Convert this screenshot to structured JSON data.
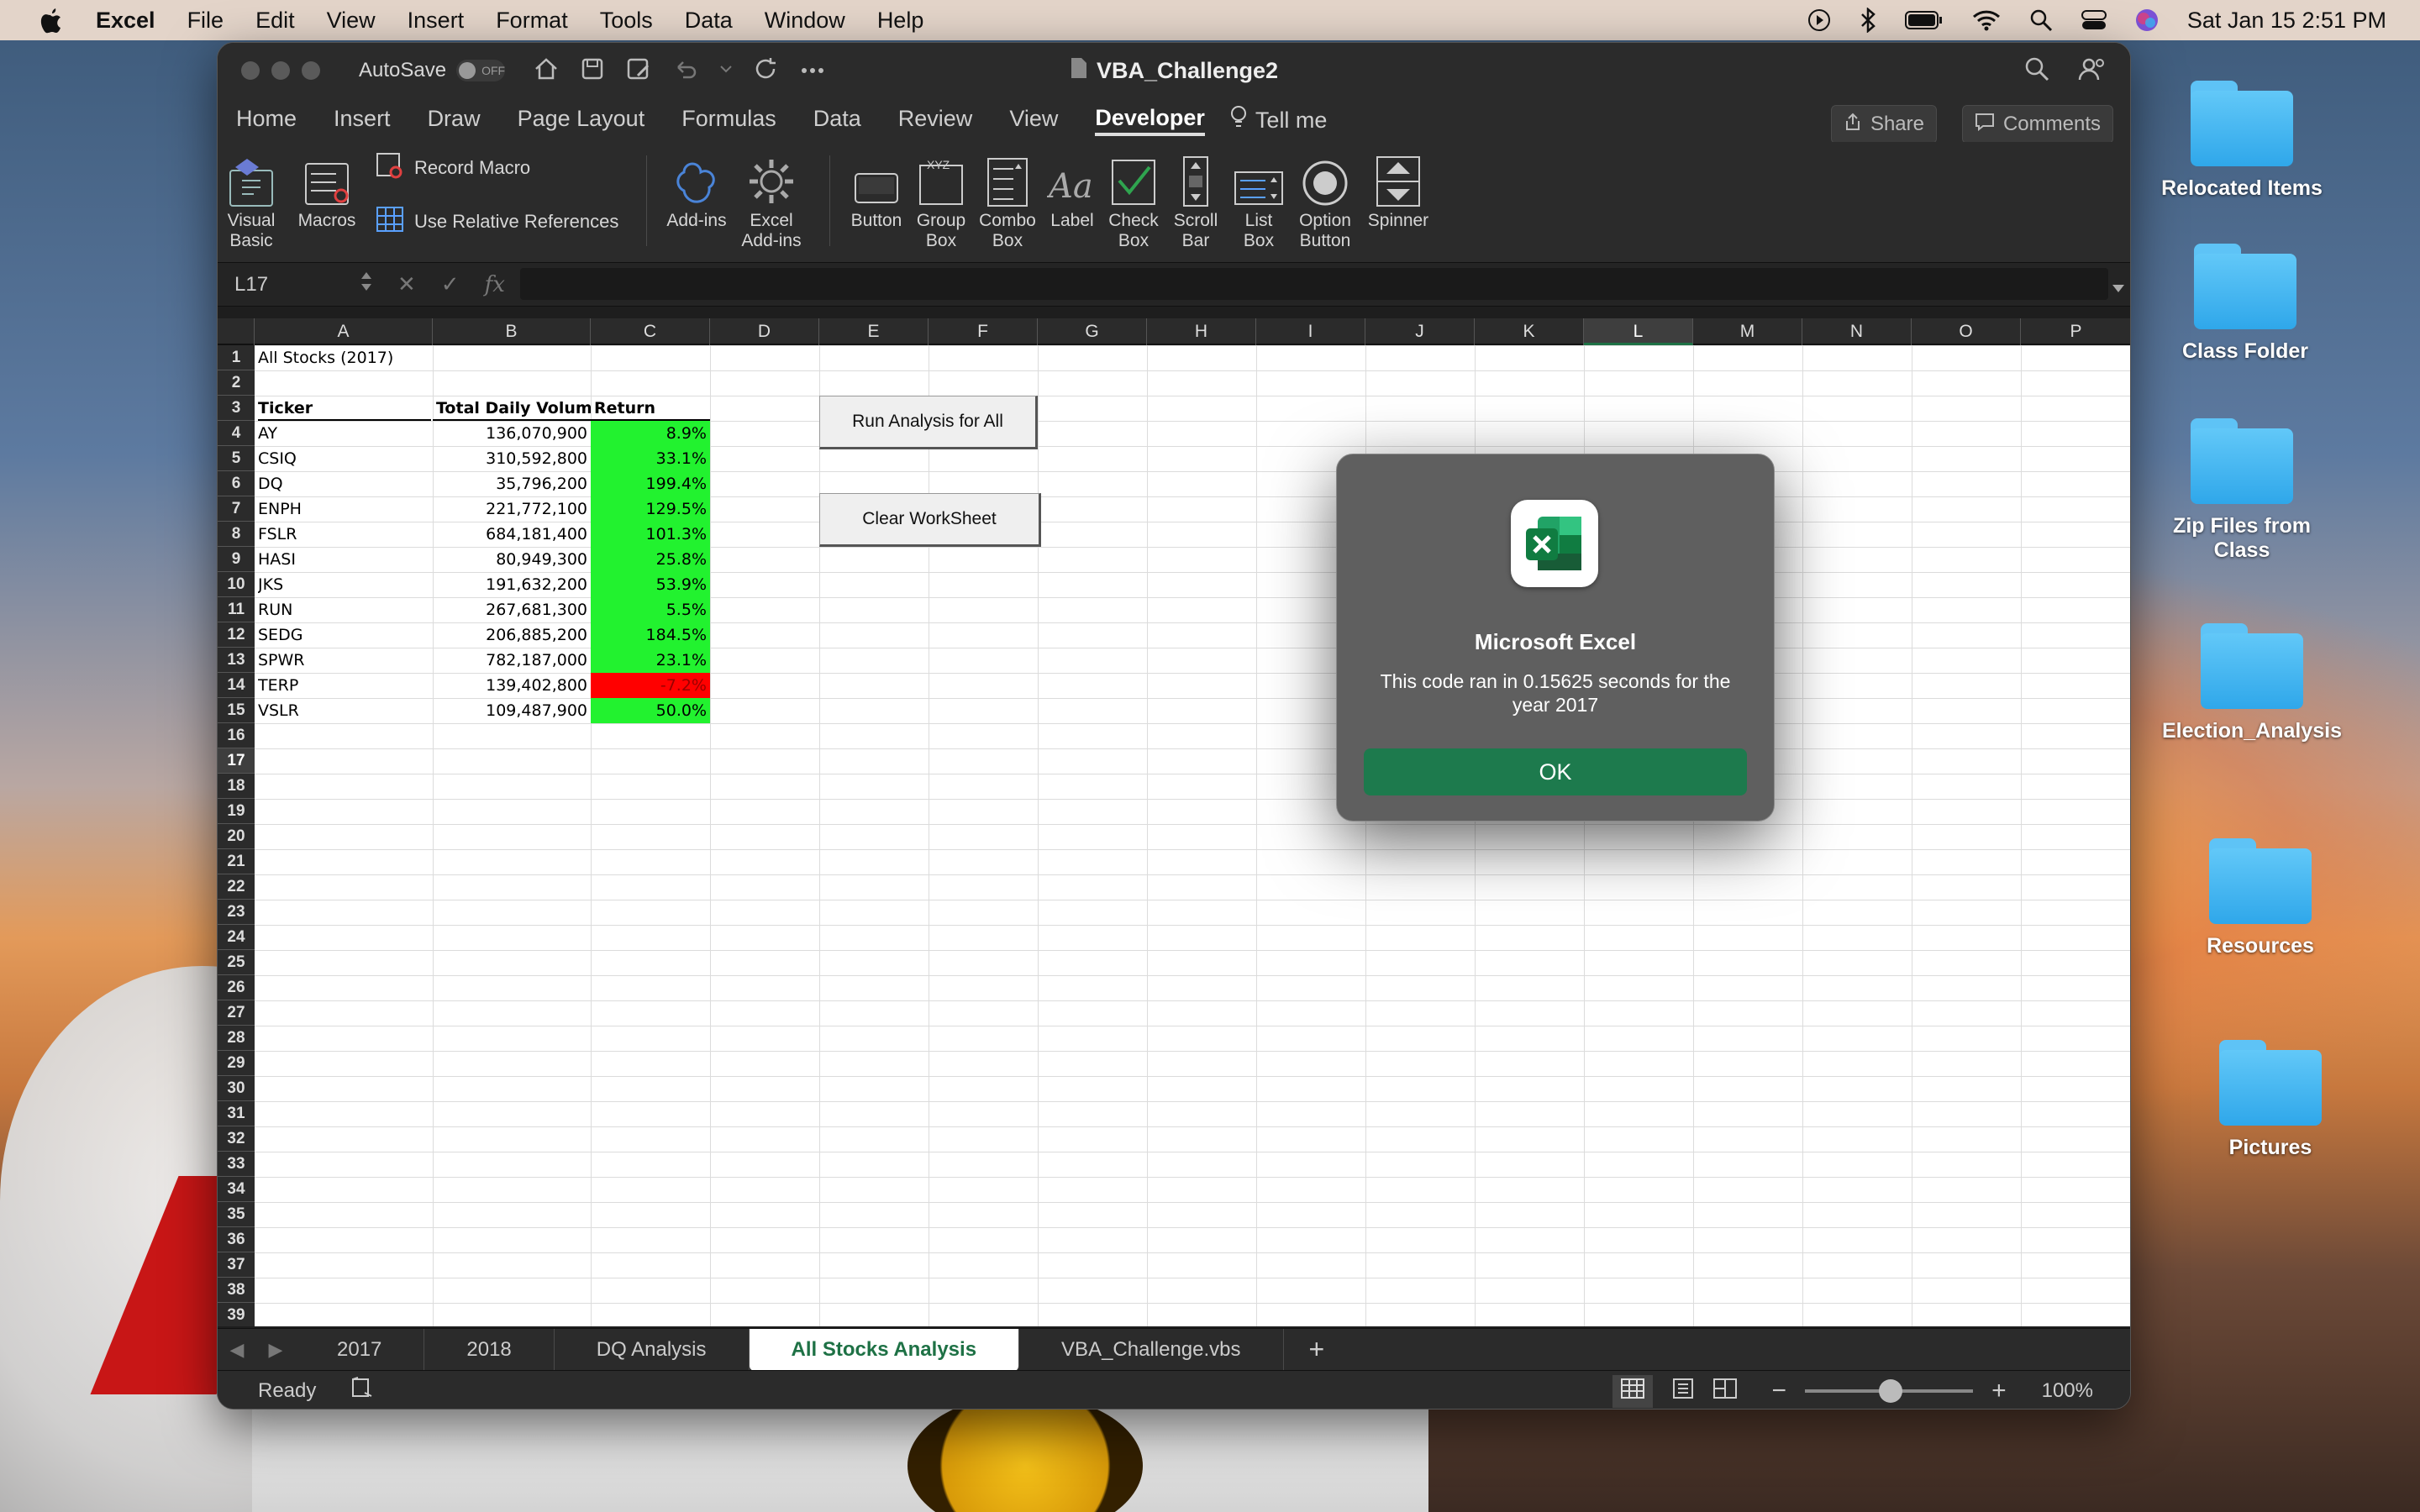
{
  "menubar": {
    "app": "Excel",
    "items": [
      "File",
      "Edit",
      "View",
      "Insert",
      "Format",
      "Tools",
      "Data",
      "Window",
      "Help"
    ],
    "clock": "Sat Jan 15  2:51 PM"
  },
  "window": {
    "autosave_label": "AutoSave",
    "autosave_state": "OFF",
    "title": "VBA_Challenge2"
  },
  "ribbon_tabs": [
    "Home",
    "Insert",
    "Draw",
    "Page Layout",
    "Formulas",
    "Data",
    "Review",
    "View",
    "Developer"
  ],
  "active_tab": "Developer",
  "tell_me": "Tell me",
  "share": "Share",
  "comments": "Comments",
  "ribbon": {
    "visual_basic": "Visual Basic",
    "macros": "Macros",
    "record_macro": "Record Macro",
    "use_relative": "Use Relative References",
    "add_ins": "Add-ins",
    "excel_add_ins": "Excel Add-ins",
    "button": "Button",
    "group_box": "Group Box",
    "combo_box": "Combo Box",
    "label": "Label",
    "check_box": "Check Box",
    "scroll_bar": "Scroll Bar",
    "list_box": "List Box",
    "option_button": "Option Button",
    "spinner": "Spinner"
  },
  "formula_bar": {
    "name_box": "L17",
    "fx": "fx",
    "value": ""
  },
  "columns": [
    "A",
    "B",
    "C",
    "D",
    "E",
    "F",
    "G",
    "H",
    "I",
    "J",
    "K",
    "L",
    "M",
    "N",
    "O",
    "P"
  ],
  "selected_column": "L",
  "selected_row": 17,
  "sheet": {
    "title": "All Stocks (2017)",
    "headers": [
      "Ticker",
      "Total Daily Volume",
      "Return"
    ],
    "rows": [
      {
        "ticker": "AY",
        "volume": "136,070,900",
        "ret": "8.9%",
        "positive": true
      },
      {
        "ticker": "CSIQ",
        "volume": "310,592,800",
        "ret": "33.1%",
        "positive": true
      },
      {
        "ticker": "DQ",
        "volume": "35,796,200",
        "ret": "199.4%",
        "positive": true
      },
      {
        "ticker": "ENPH",
        "volume": "221,772,100",
        "ret": "129.5%",
        "positive": true
      },
      {
        "ticker": "FSLR",
        "volume": "684,181,400",
        "ret": "101.3%",
        "positive": true
      },
      {
        "ticker": "HASI",
        "volume": "80,949,300",
        "ret": "25.8%",
        "positive": true
      },
      {
        "ticker": "JKS",
        "volume": "191,632,200",
        "ret": "53.9%",
        "positive": true
      },
      {
        "ticker": "RUN",
        "volume": "267,681,300",
        "ret": "5.5%",
        "positive": true
      },
      {
        "ticker": "SEDG",
        "volume": "206,885,200",
        "ret": "184.5%",
        "positive": true
      },
      {
        "ticker": "SPWR",
        "volume": "782,187,000",
        "ret": "23.1%",
        "positive": true
      },
      {
        "ticker": "TERP",
        "volume": "139,402,800",
        "ret": "-7.2%",
        "positive": false
      },
      {
        "ticker": "VSLR",
        "volume": "109,487,900",
        "ret": "50.0%",
        "positive": true
      }
    ],
    "run_button": "Run Analysis for All",
    "clear_button": "Clear WorkSheet"
  },
  "sheet_tabs": [
    "2017",
    "2018",
    "DQ Analysis",
    "All Stocks Analysis",
    "VBA_Challenge.vbs"
  ],
  "active_sheet": "All Stocks Analysis",
  "status": {
    "ready": "Ready",
    "zoom": "100%"
  },
  "dialog": {
    "title": "Microsoft Excel",
    "message": "This code ran in 0.15625 seconds for the year 2017",
    "ok": "OK"
  },
  "desktop": [
    "Relocated Items",
    "Class Folder",
    "Zip Files from Class",
    "Election_Analysis",
    "Resources",
    "Pictures"
  ],
  "colors": {
    "positive": "#22f22f",
    "negative": "#ff0000",
    "accent": "#1d7a4d"
  }
}
